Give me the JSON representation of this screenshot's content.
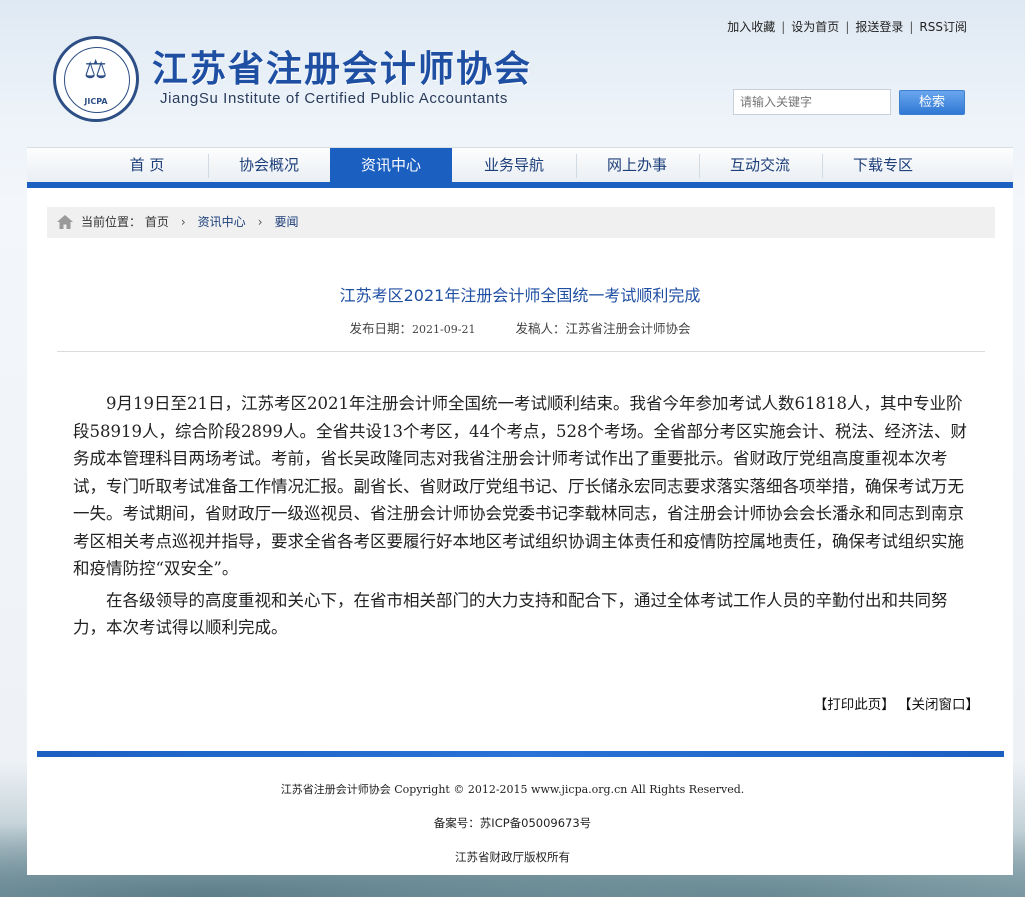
{
  "header": {
    "title": "江苏省注册会计师协会",
    "subtitle": "JiangSu Institute of Certified Public Accountants",
    "seal_abbr": "JICPA",
    "toplinks": [
      "加入收藏",
      "设为首页",
      "报送登录",
      "RSS订阅"
    ],
    "search": {
      "placeholder": "请输入关键字",
      "button": "检索"
    }
  },
  "nav": {
    "items": [
      "首 页",
      "协会概况",
      "资讯中心",
      "业务导航",
      "网上办事",
      "互动交流",
      "下载专区"
    ],
    "active": "资讯中心"
  },
  "breadcrumb": {
    "prefix": "当前位置：",
    "items": [
      "首页",
      "资讯中心",
      "要闻"
    ]
  },
  "article": {
    "title": "江苏考区2021年注册会计师全国统一考试顺利完成",
    "date_label": "发布日期：",
    "date": "2021-09-21",
    "author_label": "发稿人：",
    "author": "江苏省注册会计师协会",
    "paragraphs": [
      "9月19日至21日，江苏考区2021年注册会计师全国统一考试顺利结束。我省今年参加考试人数61818人，其中专业阶段58919人，综合阶段2899人。全省共设13个考区，44个考点，528个考场。全省部分考区实施会计、税法、经济法、财务成本管理科目两场考试。考前，省长吴政隆同志对我省注册会计师考试作出了重要批示。省财政厅党组高度重视本次考试，专门听取考试准备工作情况汇报。副省长、省财政厅党组书记、厅长储永宏同志要求落实落细各项举措，确保考试万无一失。考试期间，省财政厅一级巡视员、省注册会计师协会党委书记李载林同志，省注册会计师协会会长潘永和同志到南京考区相关考点巡视并指导，要求全省各考区要履行好本地区考试组织协调主体责任和疫情防控属地责任，确保考试组织实施和疫情防控“双安全”。",
      "在各级领导的高度重视和关心下，在省市相关部门的大力支持和配合下，通过全体考试工作人员的辛勤付出和共同努力，本次考试得以顺利完成。"
    ],
    "print": "【打印此页】",
    "close": "【关闭窗口】"
  },
  "footer": {
    "copyright": "江苏省注册会计师协会 Copyright © 2012-2015 www.jicpa.org.cn All Rights Reserved.",
    "icp": "备案号：苏ICP备05009673号",
    "owner": "江苏省财政厅版权所有"
  },
  "colors": {
    "brand": "#1b5fc1",
    "title": "#1f4fa3"
  }
}
